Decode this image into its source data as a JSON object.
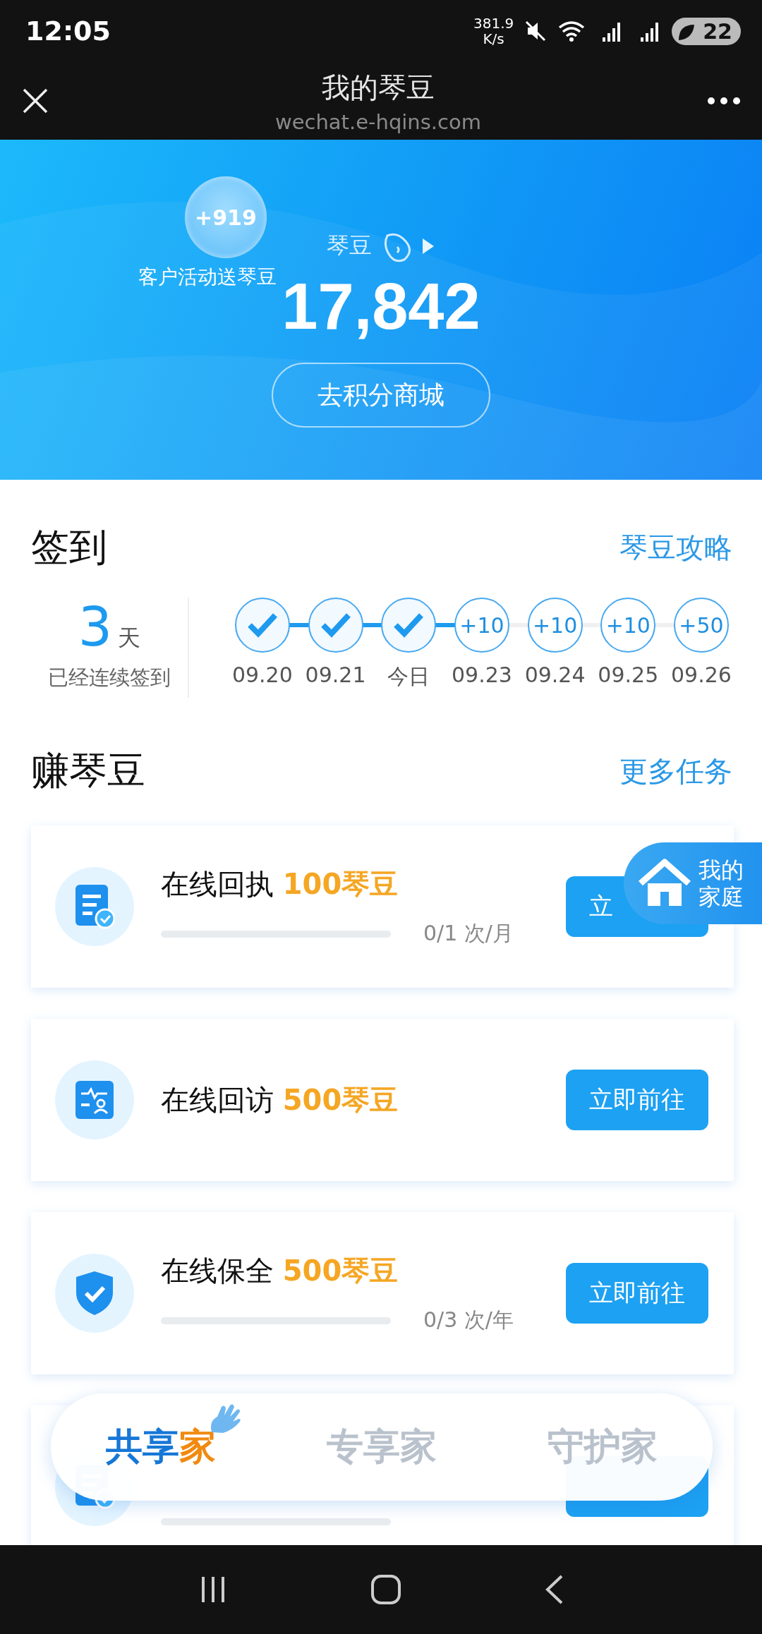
{
  "status_bar": {
    "time": "12:05",
    "net_speed": "381.9",
    "net_unit": "K/s",
    "battery": "22"
  },
  "header": {
    "title": "我的琴豆",
    "url": "wechat.e-hqins.com"
  },
  "hero": {
    "bubble": "+919",
    "bubble_label": "客户活动送琴豆",
    "points_label": "琴豆",
    "points": "17,842",
    "mall_button": "去积分商城"
  },
  "checkin": {
    "title": "签到",
    "link": "琴豆攻略",
    "streak_count": "3",
    "streak_unit": "天",
    "streak_label": "已经连续签到",
    "days": [
      {
        "date": "09.20",
        "checked": true
      },
      {
        "date": "09.21",
        "checked": true
      },
      {
        "date": "今日",
        "checked": true
      },
      {
        "date": "09.23",
        "checked": false,
        "reward": "+10"
      },
      {
        "date": "09.24",
        "checked": false,
        "reward": "+10"
      },
      {
        "date": "09.25",
        "checked": false,
        "reward": "+10"
      },
      {
        "date": "09.26",
        "checked": false,
        "reward": "+50"
      }
    ]
  },
  "earn": {
    "title": "赚琴豆",
    "link": "更多任务",
    "tasks": [
      {
        "kind": "receipt",
        "title": "在线回执",
        "reward": "100琴豆",
        "progress": {
          "level": 0,
          "text": "0/1 次/月"
        },
        "button": "立"
      },
      {
        "kind": "visit",
        "title": "在线回访",
        "reward": "500琴豆",
        "button": "立即前往"
      },
      {
        "kind": "shield",
        "title": "在线保全",
        "reward": "500琴豆",
        "progress": {
          "level": 0,
          "text": "0/3 次/年"
        },
        "button": "立即前往"
      },
      {
        "kind": "receipt",
        "progress": {
          "level": 0
        }
      }
    ]
  },
  "float_badge": {
    "line1": "我的",
    "line2": "家庭"
  },
  "tabs": [
    {
      "label": "共享",
      "accent": "家",
      "selected": true
    },
    {
      "label": "专享家",
      "selected": false
    },
    {
      "label": "守护家",
      "selected": false
    }
  ]
}
